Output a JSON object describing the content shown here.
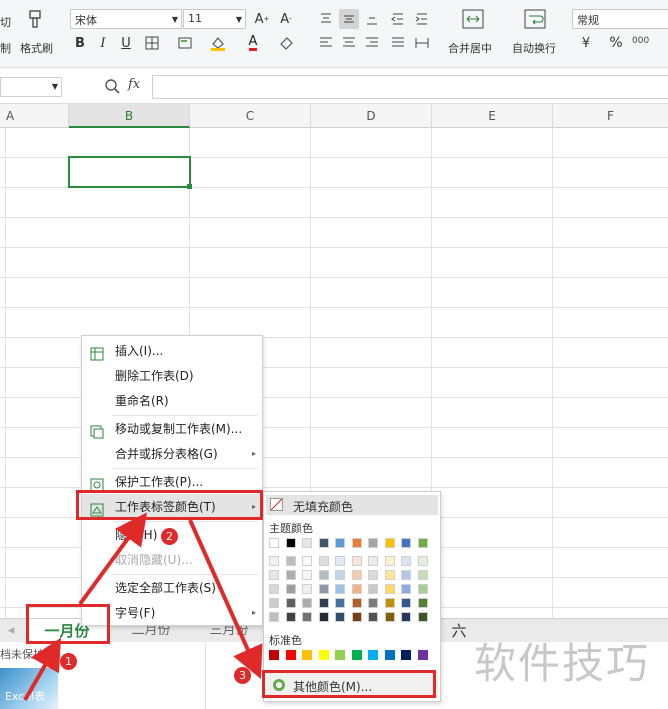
{
  "ribbon": {
    "cut_label": "切",
    "format_painter_label": "格式刷",
    "paste_label": "制",
    "font_name": "宋体",
    "font_size": "11",
    "merge_label": "合并居中",
    "wrap_label": "自动换行",
    "number_format": "常规",
    "percent": "%",
    "comma": "000"
  },
  "formula_bar": {
    "fx_label": "fx",
    "value": ""
  },
  "columns": [
    "A",
    "B",
    "C",
    "D",
    "E",
    "F"
  ],
  "sheet_tabs": [
    "一月份",
    "二月份",
    "三月份",
    "六"
  ],
  "status_left": "档未保护",
  "thumbnail_label": "Excel表",
  "context_menu": {
    "items": [
      {
        "label": "插入(I)..."
      },
      {
        "label": "删除工作表(D)"
      },
      {
        "label": "重命名(R)"
      },
      {
        "label": "移动或复制工作表(M)..."
      },
      {
        "label": "合并或拆分表格(G)"
      },
      {
        "label": "保护工作表(P)..."
      },
      {
        "label": "工作表标签颜色(T)"
      },
      {
        "label": "隐藏(H)"
      },
      {
        "label": "取消隐藏(U)..."
      },
      {
        "label": "选定全部工作表(S)"
      },
      {
        "label": "字号(F)"
      }
    ]
  },
  "color_menu": {
    "no_fill": "无填充颜色",
    "theme_title": "主题颜色",
    "standard_title": "标准色",
    "more_colors": "其他颜色(M)...",
    "theme_colors": [
      "#ffffff",
      "#000000",
      "#e7e6e6",
      "#44546a",
      "#5b9bd5",
      "#ed7d31",
      "#a5a5a5",
      "#ffc000",
      "#4472c4",
      "#70ad47"
    ],
    "standard_colors": [
      "#c00000",
      "#ff0000",
      "#ffc000",
      "#ffff00",
      "#92d050",
      "#00b050",
      "#00b0f0",
      "#0070c0",
      "#002060",
      "#7030a0"
    ]
  },
  "annotations": [
    "1",
    "2",
    "3"
  ],
  "watermark": "软件技巧"
}
